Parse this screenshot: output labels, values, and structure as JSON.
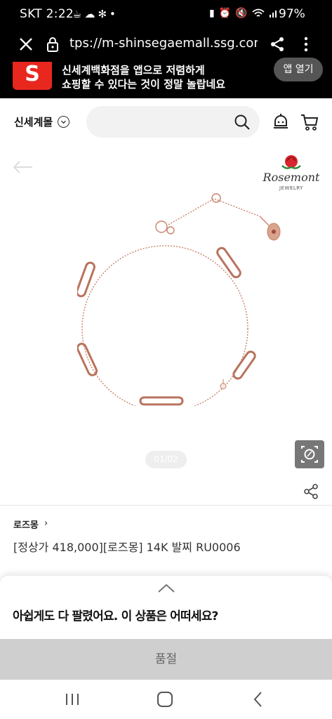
{
  "status_bar": {
    "carrier": "SKT",
    "time": "2:22",
    "battery": "97%"
  },
  "browser": {
    "url": "tps://m-shinsegaemall.ssg.com/i"
  },
  "app_banner": {
    "logo_letter": "S",
    "line1": "신세계백화점을 앱으로 저렴하게",
    "line2": "쇼핑할 수 있다는 것이 정말 놀랍네요",
    "open_button": "앱 열기"
  },
  "header": {
    "mall_name": "신세계몰"
  },
  "gallery": {
    "brand_logo": "Rosemont",
    "brand_logo_sub": "JEWELRY",
    "pager": "01/02"
  },
  "product": {
    "brand": "로즈몽",
    "title": "[정상가 418,000][로즈몽] 14K 발찌 RU0006"
  },
  "bottom_sheet": {
    "message": "아쉽게도 다 팔렸어요. 이 상품은 어떠세요?",
    "button": "품절"
  },
  "colors": {
    "accent_red": "#e8271f",
    "rose_gold": "#c9826a",
    "soldout_bg": "#cfcfcf"
  }
}
